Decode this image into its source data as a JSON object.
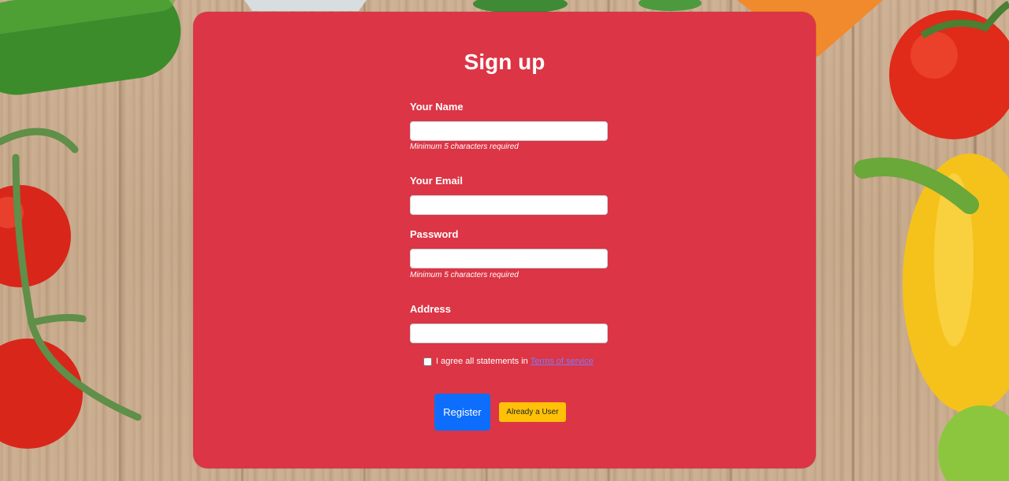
{
  "form": {
    "title": "Sign up",
    "fields": {
      "name": {
        "label": "Your Name",
        "value": "",
        "hint": "Minimum 5 characters required"
      },
      "email": {
        "label": "Your Email",
        "value": ""
      },
      "password": {
        "label": "Password",
        "value": "",
        "hint": "Minimum 5 characters required"
      },
      "address": {
        "label": "Address",
        "value": ""
      }
    },
    "agree": {
      "text": "I agree all statements in",
      "link": "Terms of service",
      "checked": false
    },
    "buttons": {
      "register": "Register",
      "already_user": "Already a User"
    }
  },
  "theme": {
    "card_color": "#dc3545",
    "primary_button": "#0d6efd",
    "warning_button": "#ffc107"
  }
}
